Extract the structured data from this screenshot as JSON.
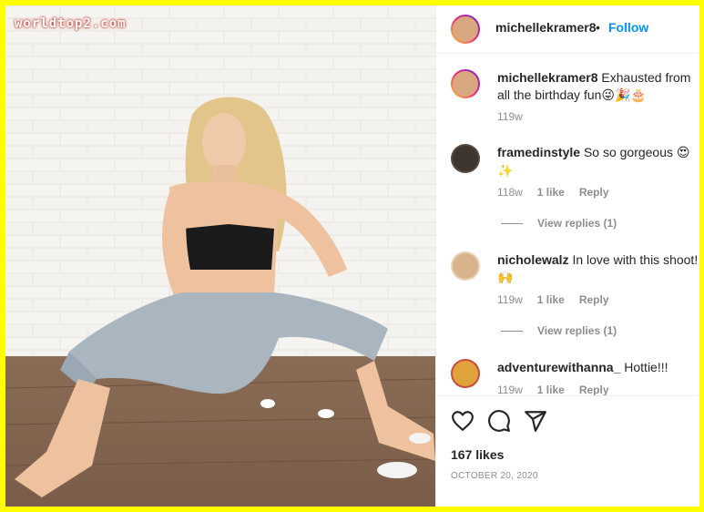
{
  "watermark": "worldtop2.com",
  "post": {
    "author": "michellekramer8",
    "follow_label": "Follow",
    "separator": "•",
    "caption": {
      "username": "michellekramer8",
      "text": "Exhausted from all the birthday fun",
      "emoji": "😜🎉🎂",
      "time": "119w"
    },
    "comments": [
      {
        "username": "framedinstyle",
        "text": "So so gorgeous",
        "emoji": "😍✨",
        "time": "118w",
        "likes": "1 like",
        "reply_label": "Reply",
        "view_replies": "View replies (1)"
      },
      {
        "username": "nicholewalz",
        "text": "In love with this shoot!",
        "emoji": "🙌",
        "time": "119w",
        "likes": "1 like",
        "reply_label": "Reply",
        "view_replies": "View replies (1)"
      },
      {
        "username": "adventurewithanna_",
        "text": "Hottie!!!",
        "emoji": "",
        "time": "119w",
        "likes": "1 like",
        "reply_label": "Reply"
      }
    ],
    "likes": "167 likes",
    "date": "OCTOBER 20, 2020"
  },
  "icons": [
    "heart-icon",
    "comment-icon",
    "share-icon"
  ],
  "colors": {
    "frame": "#ffff00",
    "link": "#0095f6",
    "muted": "#8e8e8e",
    "text": "#262626"
  }
}
